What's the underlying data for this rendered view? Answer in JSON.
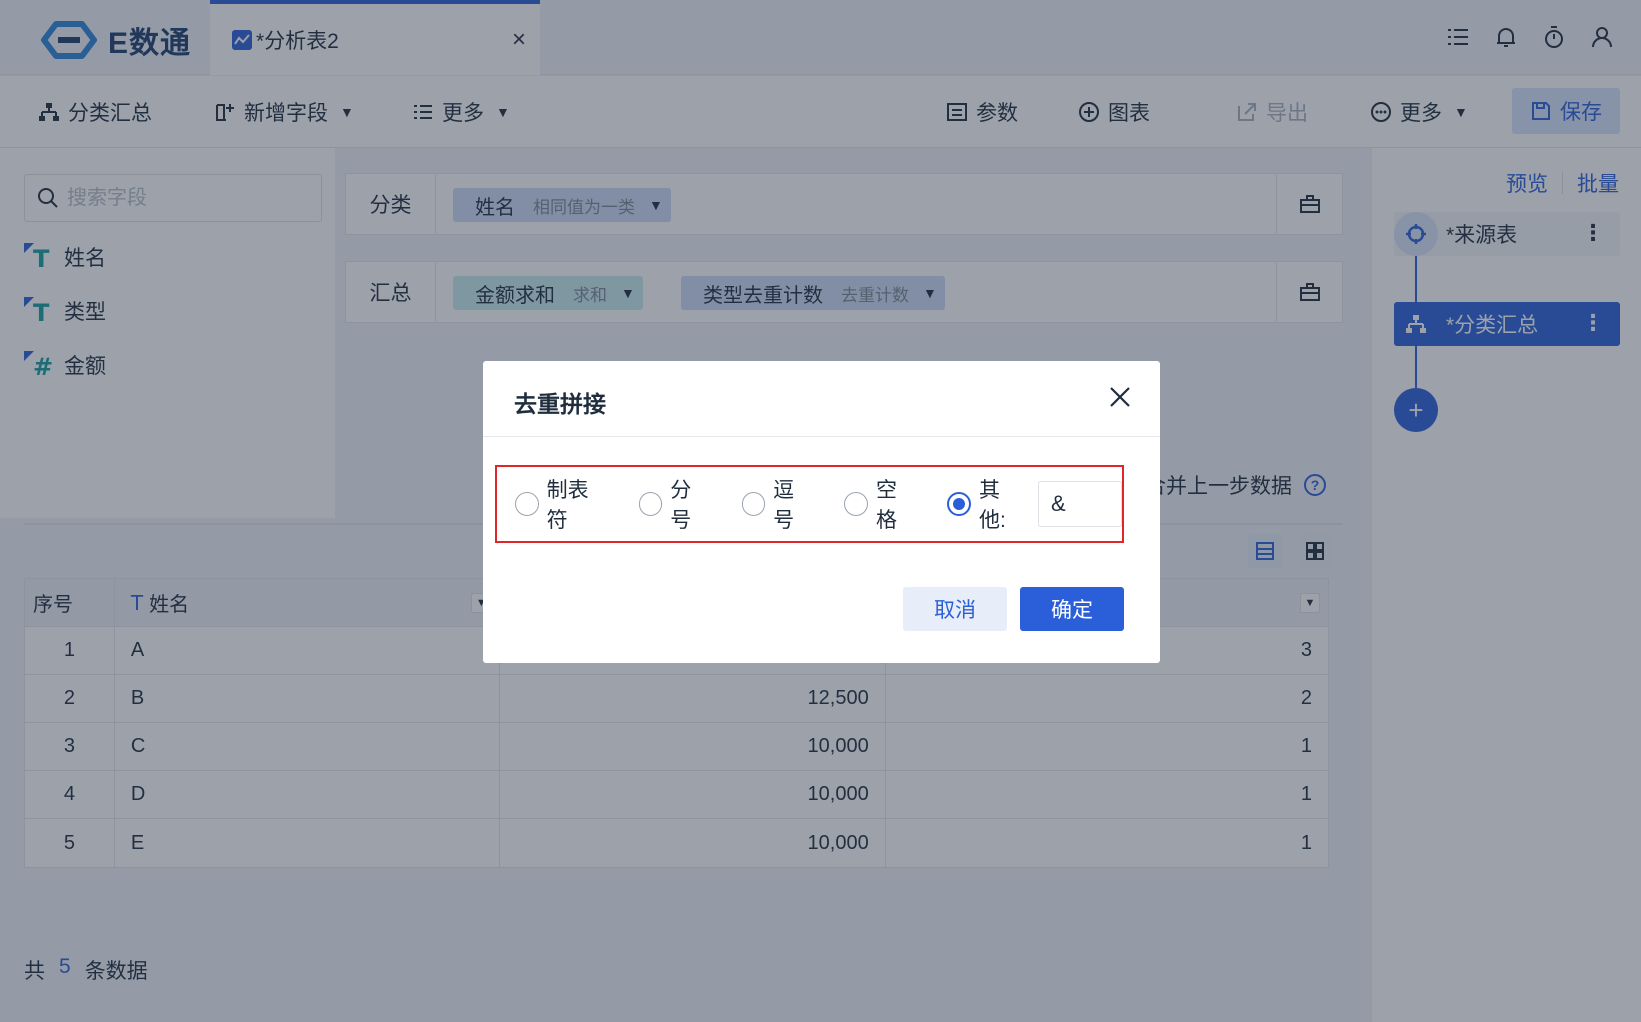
{
  "app": {
    "logo_text": "E数通"
  },
  "tab": {
    "label": "*分析表2",
    "close": "×"
  },
  "toolbar": {
    "group_summary": "分类汇总",
    "add_field": "新增字段",
    "more_left": "更多",
    "params": "参数",
    "chart": "图表",
    "export": "导出",
    "more_right": "更多",
    "save": "保存"
  },
  "left": {
    "search_placeholder": "搜索字段",
    "fields": [
      {
        "name": "姓名",
        "type": "T"
      },
      {
        "name": "类型",
        "type": "T"
      },
      {
        "name": "金额",
        "type": "#"
      }
    ]
  },
  "config": {
    "category_label": "分类",
    "category_chip": {
      "name": "姓名",
      "sub": "相同值为一类"
    },
    "summary_label": "汇总",
    "summary_chips": [
      {
        "name": "金额求和",
        "sub": "求和"
      },
      {
        "name": "类型去重计数",
        "sub": "去重计数"
      }
    ]
  },
  "right": {
    "preview": "预览",
    "batch": "批量",
    "nodes": [
      {
        "label": "*来源表"
      },
      {
        "label": "*分类汇总"
      }
    ],
    "add": "+"
  },
  "main": {
    "merge_text": "合并上一步数据",
    "help": "?"
  },
  "table": {
    "headers": {
      "index": "序号",
      "name": "姓名"
    },
    "rows": [
      {
        "idx": "1",
        "name": "A",
        "amount": "",
        "count": "3"
      },
      {
        "idx": "2",
        "name": "B",
        "amount": "12,500",
        "count": "2"
      },
      {
        "idx": "3",
        "name": "C",
        "amount": "10,000",
        "count": "1"
      },
      {
        "idx": "4",
        "name": "D",
        "amount": "10,000",
        "count": "1"
      },
      {
        "idx": "5",
        "name": "E",
        "amount": "10,000",
        "count": "1"
      }
    ]
  },
  "footer": {
    "prefix": "共",
    "count": "5",
    "suffix": "条数据"
  },
  "dialog": {
    "title": "去重拼接",
    "options": [
      {
        "label": "制表符",
        "checked": false
      },
      {
        "label": "分号",
        "checked": false
      },
      {
        "label": "逗号",
        "checked": false
      },
      {
        "label": "空格",
        "checked": false
      },
      {
        "label": "其他:",
        "checked": true
      }
    ],
    "other_value": "&",
    "cancel": "取消",
    "confirm": "确定"
  },
  "colors": {
    "accent": "#2b5fd9",
    "highlight_border": "#e0262b"
  }
}
